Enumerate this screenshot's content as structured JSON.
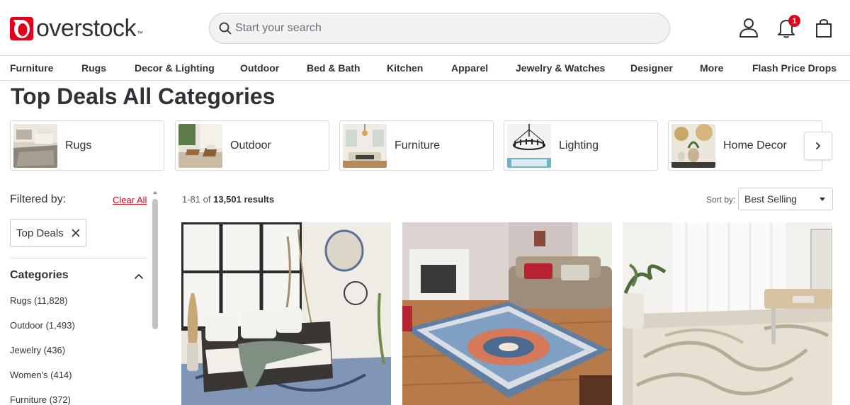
{
  "header": {
    "logo_text": "overstock",
    "logo_tm": "™",
    "search_placeholder": "Start your search",
    "notification_count": "1",
    "brand_color": "#e2001a"
  },
  "nav": {
    "items": [
      "Furniture",
      "Rugs",
      "Decor & Lighting",
      "Outdoor",
      "Bed & Bath",
      "Kitchen",
      "Apparel",
      "Jewelry & Watches",
      "Designer",
      "More",
      "Flash Price Drops"
    ]
  },
  "page": {
    "title": "Top Deals All Categories"
  },
  "category_cards": [
    {
      "label": "Rugs"
    },
    {
      "label": "Outdoor"
    },
    {
      "label": "Furniture"
    },
    {
      "label": "Lighting"
    },
    {
      "label": "Home Decor"
    }
  ],
  "filters": {
    "filtered_by": "Filtered by:",
    "clear_all": "Clear All",
    "active_chip": "Top Deals",
    "categories_heading": "Categories",
    "facets": [
      "Rugs (11,828)",
      "Outdoor (1,493)",
      "Jewelry (436)",
      "Women's (414)",
      "Furniture (372)"
    ]
  },
  "results": {
    "range": "1-81 of",
    "total": "13,501 results",
    "sort_label": "Sort by:",
    "sort_value": "Best Selling"
  },
  "icons": {
    "search": "search-icon",
    "account": "user-icon",
    "notifications": "bell-icon",
    "cart": "shopping-bag-icon",
    "next": "chevron-right-icon",
    "remove": "close-icon",
    "collapse": "chevron-up-icon"
  }
}
